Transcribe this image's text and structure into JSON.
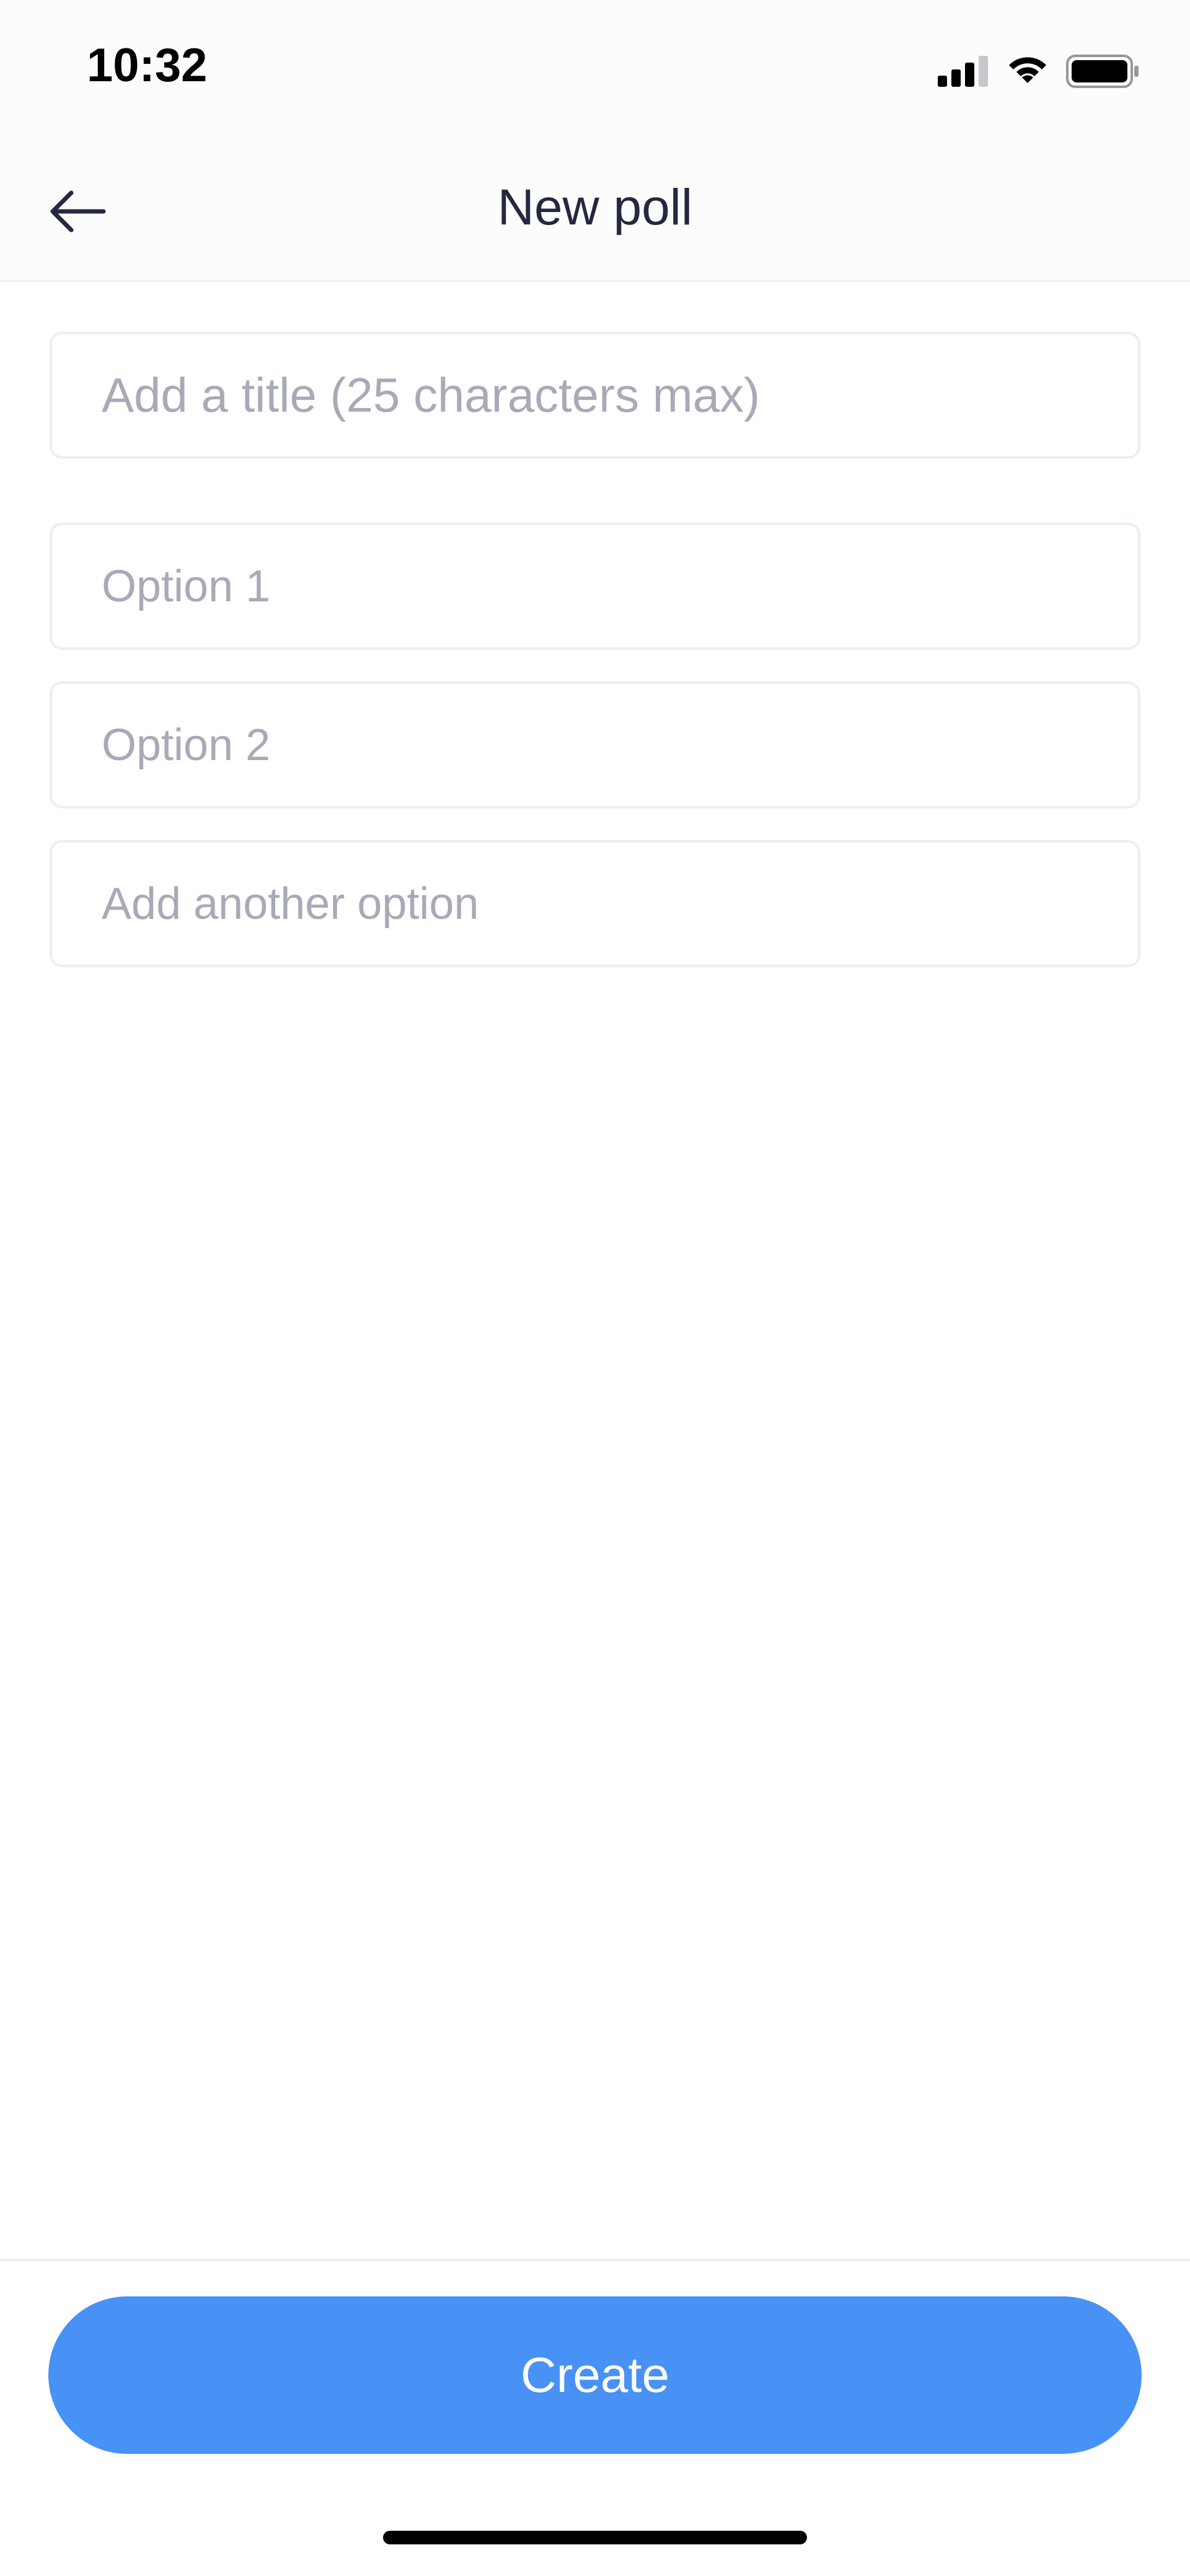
{
  "status_bar": {
    "time": "10:32",
    "icons": [
      "signal-icon",
      "wifi-icon",
      "battery-icon"
    ]
  },
  "header": {
    "title": "New poll",
    "back_icon": "arrow-left-icon"
  },
  "form": {
    "title_placeholder": "Add a title (25 characters max)",
    "title_value": "",
    "options": [
      {
        "placeholder": "Option 1",
        "value": ""
      },
      {
        "placeholder": "Option 2",
        "value": ""
      }
    ],
    "add_option_placeholder": "Add another option"
  },
  "footer": {
    "create_label": "Create"
  },
  "colors": {
    "accent": "#4891f5",
    "title_text": "#252841",
    "placeholder_text": "#a8aab8",
    "border": "#eceef1"
  }
}
